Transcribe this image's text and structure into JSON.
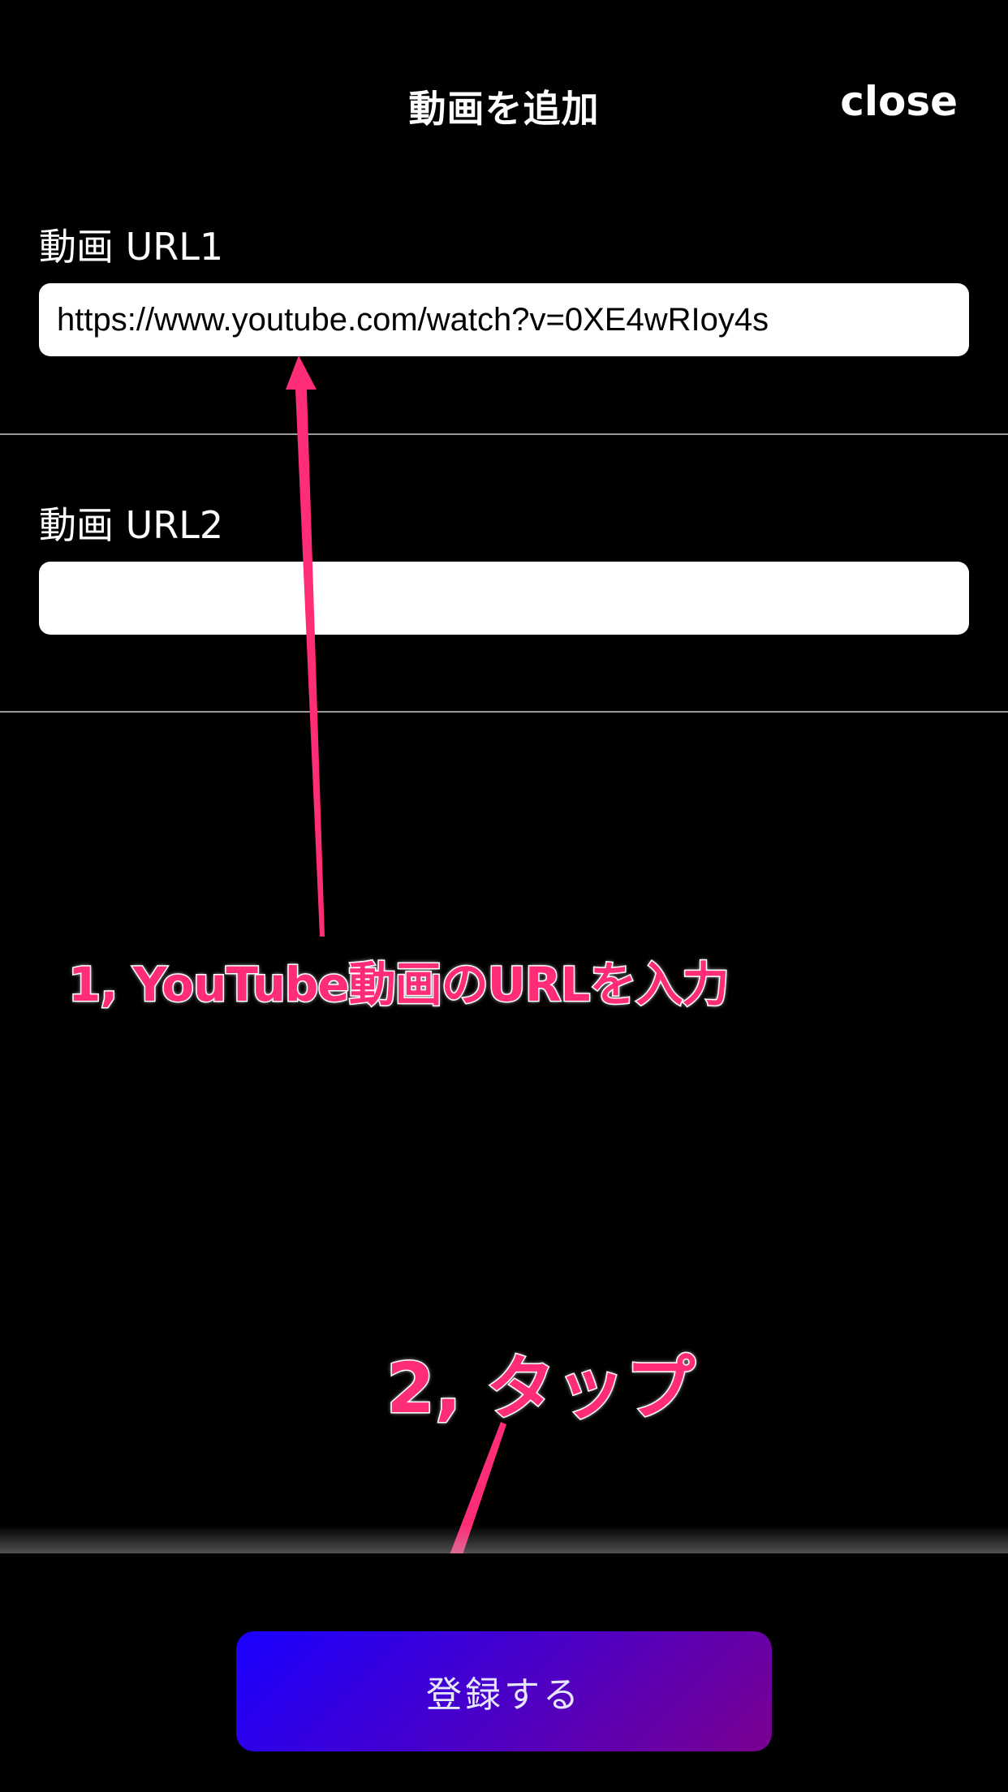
{
  "header": {
    "title": "動画を追加",
    "close_label": "close"
  },
  "form": {
    "url1": {
      "label": "動画 URL1",
      "value": "https://www.youtube.com/watch?v=0XE4wRIoy4s",
      "placeholder": ""
    },
    "url2": {
      "label": "動画 URL2",
      "value": "",
      "placeholder": ""
    }
  },
  "annotations": {
    "step1": "1, YouTube動画のURLを入力",
    "step2": "2, タップ",
    "color": "#ff2d78"
  },
  "footer": {
    "submit_label": "登録する"
  },
  "colors": {
    "background": "#000000",
    "button_gradient_start": "#1a00ff",
    "button_gradient_end": "#7a0090"
  }
}
